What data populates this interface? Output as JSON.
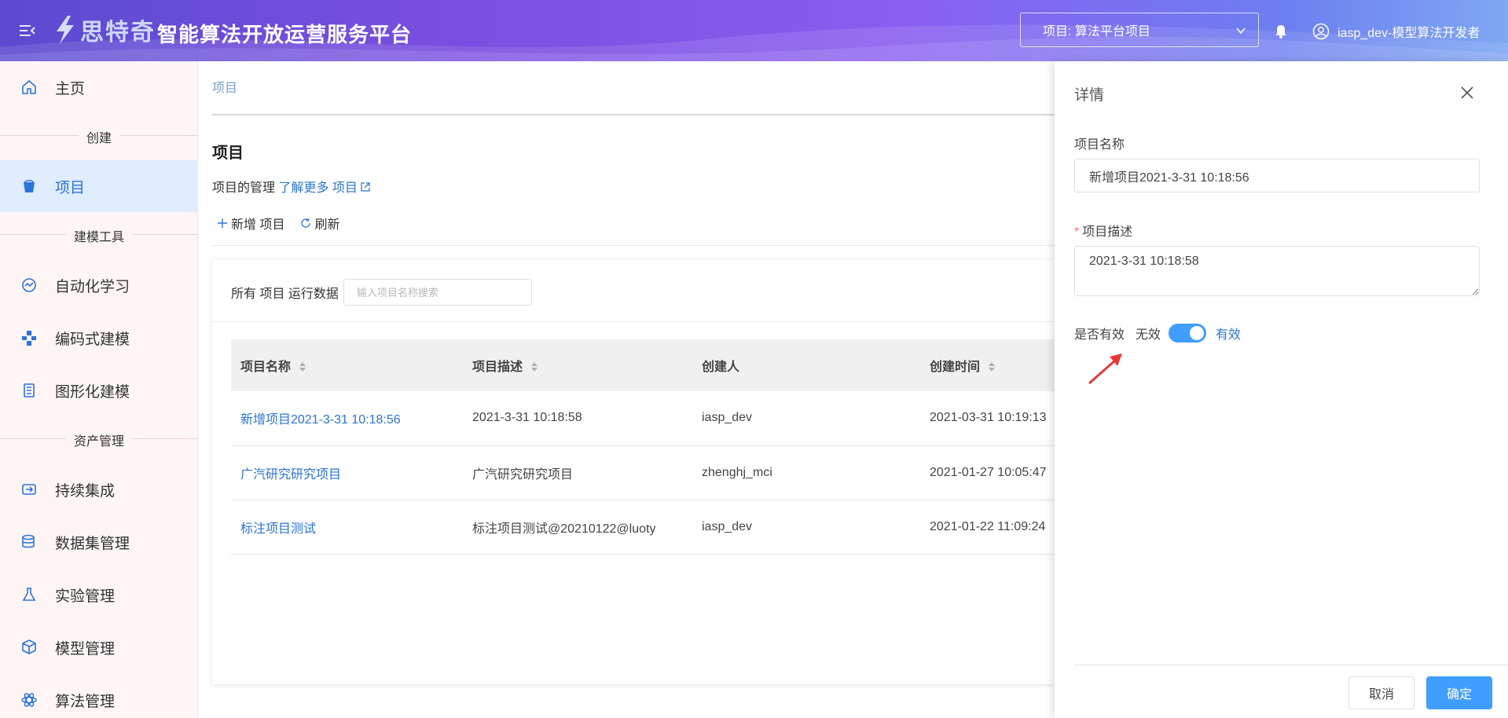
{
  "header": {
    "brand_name": "思特奇",
    "platform_title": "智能算法开放运营服务平台",
    "project_select_label": "项目: 算法平台项目",
    "user_label": "iasp_dev-模型算法开发者"
  },
  "sidebar": {
    "home": "主页",
    "section_create": "创建",
    "project": "项目",
    "section_modeling": "建模工具",
    "automl": "自动化学习",
    "code_modeling": "编码式建模",
    "graph_modeling": "图形化建模",
    "section_assets": "资产管理",
    "ci": "持续集成",
    "dataset": "数据集管理",
    "experiment": "实验管理",
    "model": "模型管理",
    "algorithm": "算法管理"
  },
  "main": {
    "breadcrumb": "项目",
    "title": "项目",
    "desc_prefix": "项目的管理",
    "desc_link": "了解更多 项目",
    "add_label": "新增 项目",
    "refresh_label": "刷新",
    "card_title": "所有 项目 运行数据",
    "search_placeholder": "输入项目名称搜索",
    "columns": {
      "name": "项目名称",
      "desc": "项目描述",
      "creator": "创建人",
      "time": "创建时间"
    },
    "rows": [
      {
        "name": "新增项目2021-3-31 10:18:56",
        "desc": "2021-3-31 10:18:58",
        "creator": "iasp_dev",
        "time": "2021-03-31 10:19:13"
      },
      {
        "name": "广汽研究研究项目",
        "desc": "广汽研究研究项目",
        "creator": "zhenghj_mci",
        "time": "2021-01-27 10:05:47"
      },
      {
        "name": "标注项目测试",
        "desc": "标注项目测试@20210122@luoty",
        "creator": "iasp_dev",
        "time": "2021-01-22 11:09:24"
      }
    ]
  },
  "drawer": {
    "title": "详情",
    "name_label": "项目名称",
    "name_value": "新增项目2021-3-31 10:18:56",
    "desc_required_mark": "*",
    "desc_label": "项目描述",
    "desc_value": "2021-3-31 10:18:58",
    "valid_label": "是否有效",
    "switch_off_label": "无效",
    "switch_on_label": "有效",
    "switch_on": true,
    "cancel_label": "取消",
    "ok_label": "确定"
  },
  "colors": {
    "primary": "#409eff",
    "link": "#2a74d9",
    "sidebar_bg": "#fff5f5",
    "sidebar_active_bg": "#e0ecff"
  }
}
